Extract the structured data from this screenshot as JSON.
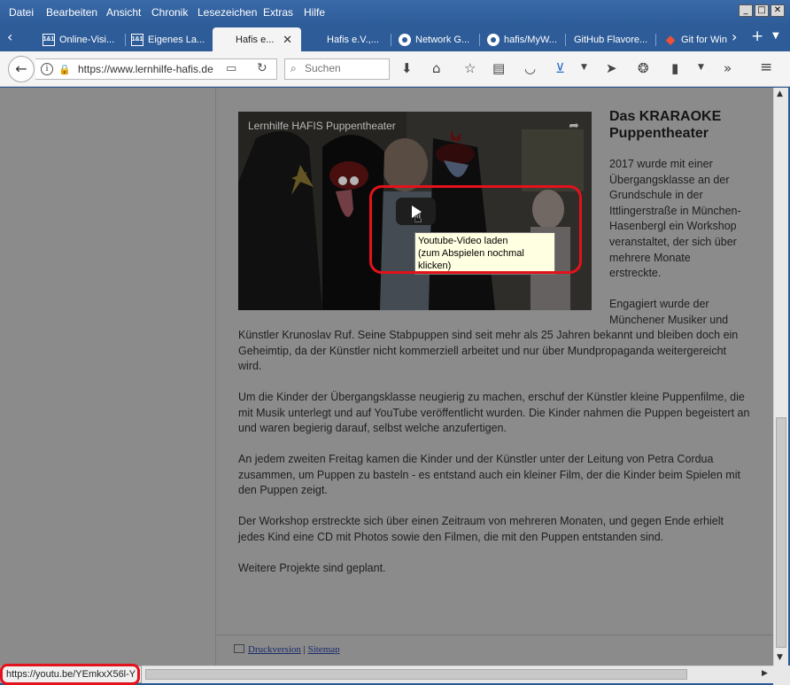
{
  "menu": [
    "Datei",
    "Bearbeiten",
    "Ansicht",
    "Chronik",
    "Lesezeichen",
    "Extras",
    "Hilfe"
  ],
  "tabs": [
    {
      "label": "Online-Visi...",
      "icon": "1and1-icon",
      "fav": "1&1"
    },
    {
      "label": "Eigenes La...",
      "icon": "1and1-icon",
      "fav": "1&1"
    },
    {
      "label": "Hafis e...",
      "icon": "",
      "fav": ""
    },
    {
      "label": "Hafis e.V.,...",
      "icon": "",
      "fav": ""
    },
    {
      "label": "Network G...",
      "icon": "github-icon",
      "fav": ""
    },
    {
      "label": "hafis/MyW...",
      "icon": "github-icon",
      "fav": ""
    },
    {
      "label": "GitHub Flavore...",
      "icon": "",
      "fav": ""
    },
    {
      "label": "Git for Win",
      "icon": "git-icon",
      "fav": "◆"
    }
  ],
  "address": {
    "url": "https://www.lernhilfe-hafis.de"
  },
  "search": {
    "placeholder": "Suchen"
  },
  "video": {
    "title": "Lernhilfe HAFIS Puppentheater",
    "tooltip_line1": "Youtube-Video laden",
    "tooltip_line2": "(zum Abspielen nochmal klicken)"
  },
  "article": {
    "heading": "Das KRARAOKE Puppentheater",
    "p1": "2017 wurde mit einer Übergangsklasse an der Grundschule in der Ittlingerstraße in München-Hasenbergl ein Workshop veranstaltet, der sich über mehrere Monate erstreckte.",
    "p2a": "Engagiert wurde der Münchener Musiker und",
    "p2b": "Künstler Krunoslav Ruf. Seine Stabpuppen sind seit mehr als 25 Jahren bekannt und bleiben doch ein Geheimtip, da der Künstler nicht kommerziell arbeitet und nur über Mundpropaganda weitergereicht wird.",
    "p3": "Um die Kinder der Übergangsklasse neugierig zu machen, erschuf der Künstler kleine Puppenfilme, die mit Musik unterlegt und auf YouTube veröffentlicht wurden. Die Kinder nahmen die Puppen begeistert an und waren begierig darauf, selbst welche anzufertigen.",
    "p4": "An jedem zweiten Freitag kamen die Kinder und der Künstler unter der Leitung von Petra Cordua zusammen, um Puppen zu basteln - es entstand auch ein kleiner Film, der die Kinder beim Spielen mit den Puppen zeigt.",
    "p5": "Der Workshop erstreckte sich über einen Zeitraum von mehreren Monaten, und gegen Ende erhielt jedes Kind eine CD mit Photos sowie den Filmen, die mit den Puppen entstanden sind.",
    "p6": "Weitere Projekte sind geplant."
  },
  "footer": {
    "print": "Druckversion",
    "sep": "|",
    "sitemap": "Sitemap"
  },
  "status": {
    "url": "https://youtu.be/YEmkxX56l-Y"
  },
  "colors": {
    "highlight": "#e3121b",
    "titlebar": "#2d5c99"
  }
}
